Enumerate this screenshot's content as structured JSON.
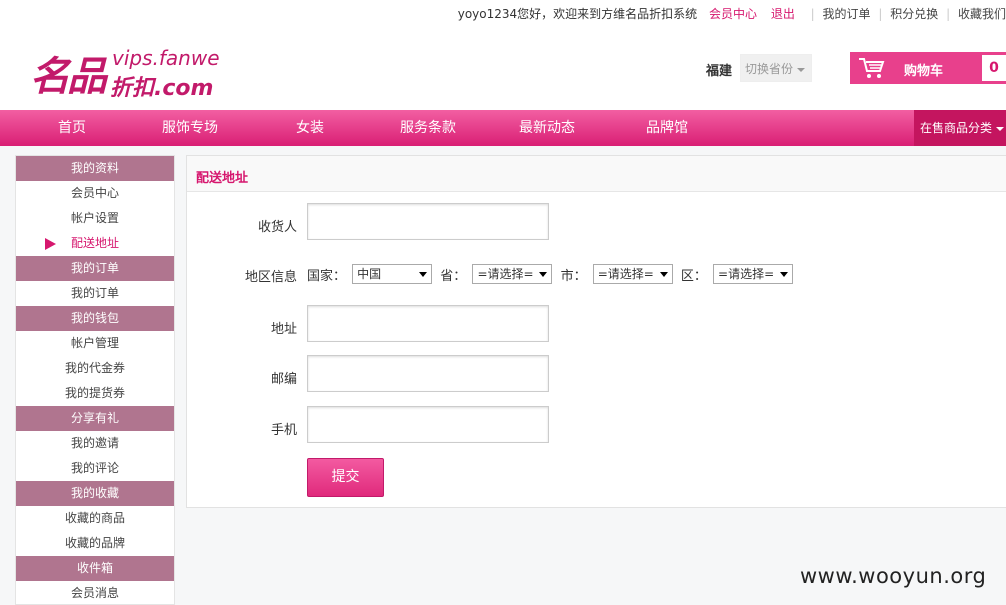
{
  "topbar": {
    "greeting": "yoyo1234您好，欢迎来到方维名品折扣系统",
    "member_center": "会员中心",
    "logout": "退出",
    "my_orders": "我的订单",
    "points_exchange": "积分兑换",
    "favorites": "收藏我们"
  },
  "header": {
    "logo_cn": "名品",
    "logo_en": "vips.fanwe",
    "logo_cn2": "折扣.com",
    "province": "福建",
    "switch_province": "切换省份",
    "cart_label": "购物车",
    "cart_count": "0"
  },
  "nav": {
    "items": [
      "首页",
      "服饰专场",
      "女装",
      "服务条款",
      "最新动态",
      "品牌馆"
    ],
    "category": "在售商品分类"
  },
  "sidebar": {
    "g1": "我的资料",
    "i1": "会员中心",
    "i2": "帐户设置",
    "i3": "配送地址",
    "g2": "我的订单",
    "i4": "我的订单",
    "g3": "我的钱包",
    "i5": "帐户管理",
    "i6": "我的代金券",
    "i7": "我的提货券",
    "g4": "分享有礼",
    "i8": "我的邀请",
    "i9": "我的评论",
    "g5": "我的收藏",
    "i10": "收藏的商品",
    "i11": "收藏的品牌",
    "g6": "收件箱",
    "i12": "会员消息"
  },
  "form": {
    "title": "配送地址",
    "consignee_label": "收货人",
    "consignee_value": "",
    "region_label": "地区信息",
    "country_label": "国家：",
    "country_value": "中国",
    "province_label": "省：",
    "province_value": "=请选择=",
    "city_label": "市：",
    "city_value": "=请选择=",
    "district_label": "区：",
    "district_value": "=请选择=",
    "address_label": "地址",
    "address_value": "",
    "zip_label": "邮编",
    "zip_value": "",
    "mobile_label": "手机",
    "mobile_value": "",
    "submit_label": "提交"
  },
  "watermark": "www.wooyun.org",
  "colors": {
    "accent": "#d6176e",
    "nav": "#e8408c",
    "sidebar_group": "#b0758f"
  }
}
